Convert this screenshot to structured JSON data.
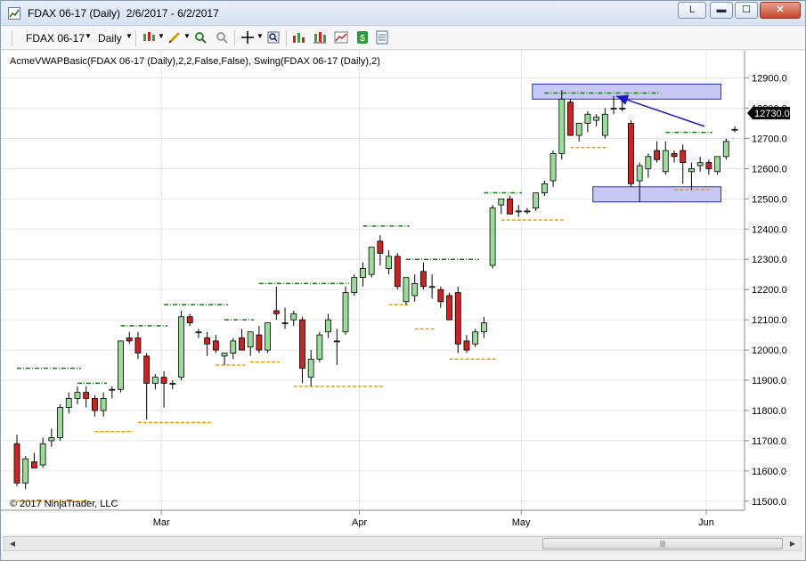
{
  "window": {
    "title": "FDAX 06-17 (Daily)  2/6/2017 - 6/2/2017",
    "restore_label": "L"
  },
  "toolbar": {
    "instrument": "FDAX 06-17",
    "interval": "Daily"
  },
  "chart": {
    "indicator_label": "AcmeVWAPBasic(FDAX 06-17 (Daily),2,2,False,False), Swing(FDAX 06-17 (Daily),2)",
    "copyright": "© 2017 NinjaTrader, LLC",
    "last_price": "12730.0",
    "colors": {
      "up": "#99dd99",
      "down": "#cc2222",
      "swing_high": "#1a7a1a",
      "swing_low": "#e8a000",
      "zone_fill": "#c8c8f4",
      "zone_stroke": "#2a2acc",
      "arrow": "#1a1acc"
    }
  },
  "chart_data": {
    "type": "candlestick",
    "y_ticks": [
      "12900.0",
      "12800.0",
      "12700.0",
      "12600.0",
      "12500.0",
      "12400.0",
      "12300.0",
      "12200.0",
      "12100.0",
      "12000.0",
      "11900.0",
      "11800.0",
      "11700.0",
      "11600.0",
      "11500.0"
    ],
    "ylim": [
      11470,
      12990
    ],
    "x_labels": [
      "Mar",
      "Apr",
      "May",
      "Jun"
    ],
    "grid": true,
    "candles": [
      {
        "o": 11690,
        "h": 11720,
        "l": 11550,
        "c": 11560
      },
      {
        "o": 11560,
        "h": 11650,
        "l": 11540,
        "c": 11640
      },
      {
        "o": 11630,
        "h": 11660,
        "l": 11610,
        "c": 11610
      },
      {
        "o": 11620,
        "h": 11710,
        "l": 11610,
        "c": 11690
      },
      {
        "o": 11700,
        "h": 11740,
        "l": 11680,
        "c": 11710
      },
      {
        "o": 11710,
        "h": 11820,
        "l": 11700,
        "c": 11810
      },
      {
        "o": 11810,
        "h": 11860,
        "l": 11790,
        "c": 11840
      },
      {
        "o": 11840,
        "h": 11880,
        "l": 11820,
        "c": 11860
      },
      {
        "o": 11860,
        "h": 11880,
        "l": 11810,
        "c": 11840
      },
      {
        "o": 11840,
        "h": 11850,
        "l": 11780,
        "c": 11800
      },
      {
        "o": 11800,
        "h": 11860,
        "l": 11780,
        "c": 11840
      },
      {
        "o": 11870,
        "h": 11880,
        "l": 11840,
        "c": 11870
      },
      {
        "o": 11870,
        "h": 12030,
        "l": 11860,
        "c": 12030
      },
      {
        "o": 12040,
        "h": 12060,
        "l": 12020,
        "c": 12030
      },
      {
        "o": 12040,
        "h": 12060,
        "l": 11970,
        "c": 11990
      },
      {
        "o": 11980,
        "h": 11990,
        "l": 11770,
        "c": 11890
      },
      {
        "o": 11890,
        "h": 11920,
        "l": 11870,
        "c": 11910
      },
      {
        "o": 11910,
        "h": 11930,
        "l": 11810,
        "c": 11890
      },
      {
        "o": 11890,
        "h": 11900,
        "l": 11870,
        "c": 11890
      },
      {
        "o": 11910,
        "h": 12130,
        "l": 11900,
        "c": 12110
      },
      {
        "o": 12110,
        "h": 12120,
        "l": 12080,
        "c": 12090
      },
      {
        "o": 12060,
        "h": 12070,
        "l": 12040,
        "c": 12060
      },
      {
        "o": 12040,
        "h": 12060,
        "l": 11980,
        "c": 12020
      },
      {
        "o": 12030,
        "h": 12050,
        "l": 11990,
        "c": 12000
      },
      {
        "o": 11980,
        "h": 11990,
        "l": 11950,
        "c": 11990
      },
      {
        "o": 11990,
        "h": 12040,
        "l": 11970,
        "c": 12030
      },
      {
        "o": 12040,
        "h": 12070,
        "l": 12000,
        "c": 12000
      },
      {
        "o": 12010,
        "h": 12060,
        "l": 11980,
        "c": 12060
      },
      {
        "o": 12050,
        "h": 12080,
        "l": 11990,
        "c": 12000
      },
      {
        "o": 12000,
        "h": 12090,
        "l": 11990,
        "c": 12090
      },
      {
        "o": 12130,
        "h": 12210,
        "l": 12100,
        "c": 12120
      },
      {
        "o": 12090,
        "h": 12140,
        "l": 12070,
        "c": 12090
      },
      {
        "o": 12100,
        "h": 12130,
        "l": 12080,
        "c": 12120
      },
      {
        "o": 12100,
        "h": 12110,
        "l": 11890,
        "c": 11940
      },
      {
        "o": 11910,
        "h": 12000,
        "l": 11880,
        "c": 11970
      },
      {
        "o": 11970,
        "h": 12060,
        "l": 11960,
        "c": 12050
      },
      {
        "o": 12060,
        "h": 12120,
        "l": 12040,
        "c": 12100
      },
      {
        "o": 12030,
        "h": 12070,
        "l": 11950,
        "c": 12030
      },
      {
        "o": 12060,
        "h": 12210,
        "l": 12050,
        "c": 12190
      },
      {
        "o": 12190,
        "h": 12250,
        "l": 12180,
        "c": 12240
      },
      {
        "o": 12240,
        "h": 12290,
        "l": 12210,
        "c": 12270
      },
      {
        "o": 12250,
        "h": 12340,
        "l": 12240,
        "c": 12340
      },
      {
        "o": 12360,
        "h": 12380,
        "l": 12280,
        "c": 12320
      },
      {
        "o": 12270,
        "h": 12330,
        "l": 12250,
        "c": 12310
      },
      {
        "o": 12310,
        "h": 12320,
        "l": 12200,
        "c": 12210
      },
      {
        "o": 12160,
        "h": 12240,
        "l": 12150,
        "c": 12240
      },
      {
        "o": 12180,
        "h": 12250,
        "l": 12160,
        "c": 12220
      },
      {
        "o": 12260,
        "h": 12290,
        "l": 12200,
        "c": 12210
      },
      {
        "o": 12210,
        "h": 12250,
        "l": 12170,
        "c": 12210
      },
      {
        "o": 12200,
        "h": 12210,
        "l": 12140,
        "c": 12160
      },
      {
        "o": 12180,
        "h": 12190,
        "l": 12100,
        "c": 12100
      },
      {
        "o": 12190,
        "h": 12210,
        "l": 11990,
        "c": 12020
      },
      {
        "o": 12030,
        "h": 12050,
        "l": 11990,
        "c": 12000
      },
      {
        "o": 12020,
        "h": 12070,
        "l": 12010,
        "c": 12060
      },
      {
        "o": 12060,
        "h": 12110,
        "l": 12040,
        "c": 12090
      },
      {
        "o": 12280,
        "h": 12480,
        "l": 12270,
        "c": 12470
      },
      {
        "o": 12480,
        "h": 12500,
        "l": 12450,
        "c": 12500
      },
      {
        "o": 12500,
        "h": 12510,
        "l": 12450,
        "c": 12450
      },
      {
        "o": 12460,
        "h": 12480,
        "l": 12440,
        "c": 12460
      },
      {
        "o": 12460,
        "h": 12470,
        "l": 12450,
        "c": 12460
      },
      {
        "o": 12470,
        "h": 12520,
        "l": 12460,
        "c": 12520
      },
      {
        "o": 12520,
        "h": 12560,
        "l": 12510,
        "c": 12550
      },
      {
        "o": 12560,
        "h": 12660,
        "l": 12540,
        "c": 12650
      },
      {
        "o": 12650,
        "h": 12860,
        "l": 12630,
        "c": 12830
      },
      {
        "o": 12820,
        "h": 12830,
        "l": 12720,
        "c": 12710
      },
      {
        "o": 12710,
        "h": 12750,
        "l": 12690,
        "c": 12750
      },
      {
        "o": 12750,
        "h": 12790,
        "l": 12720,
        "c": 12780
      },
      {
        "o": 12760,
        "h": 12780,
        "l": 12740,
        "c": 12770
      },
      {
        "o": 12710,
        "h": 12800,
        "l": 12700,
        "c": 12780
      },
      {
        "o": 12800,
        "h": 12840,
        "l": 12780,
        "c": 12800
      },
      {
        "o": 12800,
        "h": 12830,
        "l": 12790,
        "c": 12800
      },
      {
        "o": 12750,
        "h": 12760,
        "l": 12540,
        "c": 12550
      },
      {
        "o": 12560,
        "h": 12620,
        "l": 12490,
        "c": 12610
      },
      {
        "o": 12600,
        "h": 12650,
        "l": 12570,
        "c": 12640
      },
      {
        "o": 12660,
        "h": 12690,
        "l": 12620,
        "c": 12630
      },
      {
        "o": 12590,
        "h": 12690,
        "l": 12580,
        "c": 12660
      },
      {
        "o": 12650,
        "h": 12660,
        "l": 12620,
        "c": 12640
      },
      {
        "o": 12660,
        "h": 12680,
        "l": 12550,
        "c": 12620
      },
      {
        "o": 12590,
        "h": 12620,
        "l": 12530,
        "c": 12600
      },
      {
        "o": 12610,
        "h": 12640,
        "l": 12590,
        "c": 12620
      },
      {
        "o": 12620,
        "h": 12630,
        "l": 12580,
        "c": 12600
      },
      {
        "o": 12590,
        "h": 12640,
        "l": 12580,
        "c": 12640
      },
      {
        "o": 12640,
        "h": 12700,
        "l": 12630,
        "c": 12690
      },
      {
        "o": 12730,
        "h": 12740,
        "l": 12720,
        "c": 12730
      }
    ],
    "swing_highs": [
      {
        "from": 0,
        "to": 7,
        "y": 11940
      },
      {
        "from": 7,
        "to": 10,
        "y": 11890
      },
      {
        "from": 12,
        "to": 17,
        "y": 12080
      },
      {
        "from": 17,
        "to": 24,
        "y": 12150
      },
      {
        "from": 24,
        "to": 27,
        "y": 12100
      },
      {
        "from": 28,
        "to": 38,
        "y": 12220
      },
      {
        "from": 40,
        "to": 45,
        "y": 12410
      },
      {
        "from": 45,
        "to": 53,
        "y": 12300
      },
      {
        "from": 54,
        "to": 58,
        "y": 12520
      },
      {
        "from": 61,
        "to": 74,
        "y": 12850
      },
      {
        "from": 75,
        "to": 80,
        "y": 12720
      }
    ],
    "swing_lows": [
      {
        "from": 0,
        "to": 8,
        "y": 11500
      },
      {
        "from": 9,
        "to": 13,
        "y": 11730
      },
      {
        "from": 14,
        "to": 22,
        "y": 11760
      },
      {
        "from": 23,
        "to": 26,
        "y": 11950
      },
      {
        "from": 27,
        "to": 30,
        "y": 11960
      },
      {
        "from": 32,
        "to": 42,
        "y": 11880
      },
      {
        "from": 43,
        "to": 45,
        "y": 12150
      },
      {
        "from": 46,
        "to": 48,
        "y": 12070
      },
      {
        "from": 50,
        "to": 55,
        "y": 11970
      },
      {
        "from": 56,
        "to": 63,
        "y": 12430
      },
      {
        "from": 64,
        "to": 68,
        "y": 12670
      },
      {
        "from": 76,
        "to": 80,
        "y": 12530
      }
    ],
    "zones": [
      {
        "from_date_index": 59.6,
        "to_date_index": 81.4,
        "top": 12880,
        "bottom": 12830
      },
      {
        "from_date_index": 66.6,
        "to_date_index": 81.4,
        "top": 12540,
        "bottom": 12490
      }
    ],
    "arrow": {
      "from_index": 79.5,
      "from_y": 12740,
      "to_index": 69.3,
      "to_y": 12840
    }
  }
}
